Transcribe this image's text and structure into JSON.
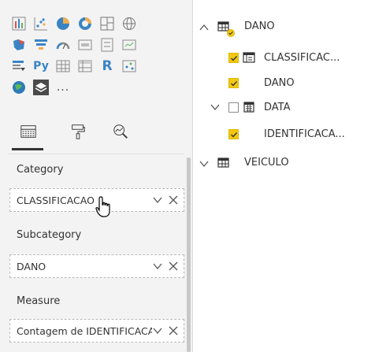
{
  "visualizations": {
    "icons": [
      "stacked-column-chart-icon",
      "scatter-chart-icon",
      "pie-chart-icon",
      "donut-chart-icon",
      "treemap-icon",
      "map-icon",
      "filled-map-icon",
      "funnel-icon",
      "gauge-icon",
      "card-icon",
      "multi-row-card-icon",
      "kpi-icon",
      "slicer-icon",
      "python-visual-icon",
      "table-icon",
      "matrix-icon",
      "r-visual-icon",
      "key-influencers-icon",
      "arcgis-map-icon",
      "custom-visual-icon"
    ],
    "python_label": "Py",
    "r_label": "R",
    "more_label": "..."
  },
  "tabs": [
    "fields-tab-icon",
    "format-paint-roller-icon",
    "analytics-magnifier-icon"
  ],
  "wells": [
    {
      "label": "Category",
      "value": "CLASSIFICACAO"
    },
    {
      "label": "Subcategory",
      "value": "DANO"
    },
    {
      "label": "Measure",
      "value": "Contagem de IDENTIFICACAO"
    }
  ],
  "fields": {
    "table_dano": "DANO",
    "items": [
      {
        "name": "CLASSIFICAC...",
        "checked": true,
        "type": "hierarchy"
      },
      {
        "name": "DANO",
        "checked": true,
        "type": "none"
      },
      {
        "name": "DATA",
        "checked": false,
        "type": "calendar",
        "expandable": true
      },
      {
        "name": "IDENTIFICACA...",
        "checked": true,
        "type": "none"
      }
    ],
    "table_veiculo": "VEICULO"
  },
  "colors": {
    "check_yellow": "#f2c811",
    "accent_blue": "#3a84c4",
    "pane_bg": "#f3f3f3"
  }
}
